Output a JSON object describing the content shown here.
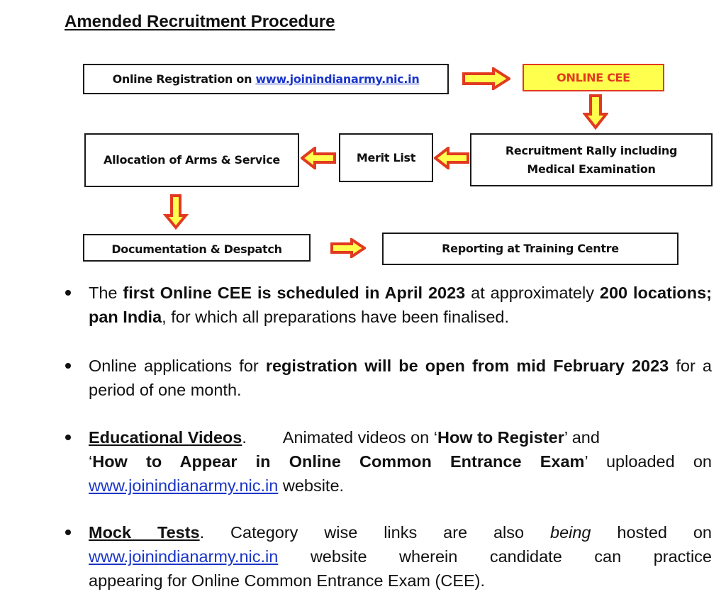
{
  "title": "Amended Recruitment Procedure",
  "flowchart": {
    "steps": {
      "registration": {
        "prefix": "Online Registration on ",
        "link": "www.joinindianarmy.nic.in"
      },
      "online_cee": "ONLINE CEE",
      "rally": {
        "line1": "Recruitment Rally including",
        "line2": "Medical Examination"
      },
      "merit_list": "Merit List",
      "allocation": "Allocation of Arms & Service",
      "documentation": "Documentation & Despatch",
      "reporting": "Reporting at Training Centre"
    },
    "colors": {
      "arrow_fill": "#ffff4d",
      "arrow_stroke": "#e23a20",
      "cee_fill": "#ffff4d",
      "cee_text": "#e23a20"
    }
  },
  "bullets": [
    {
      "t1": "The ",
      "b1": "first Online CEE is scheduled in April 2023",
      "t2": " at approximately ",
      "b2": "200 locations; pan India",
      "t3": ", for which all preparations have been finalised."
    },
    {
      "t1": "Online applications for ",
      "b1": "registration will be open from mid February 2023",
      "t2": " for a period of one month."
    },
    {
      "heading": "Educational Videos",
      "t1": ".        Animated videos on ‘",
      "b1": "How to Register",
      "t2": "’ and",
      "t3": "‘",
      "b2": "How to Appear in Online Common Entrance Exam",
      "t4": "’ uploaded on",
      "link": "www.joinindianarmy.nic.in",
      "t5": " website."
    },
    {
      "heading": "Mock Tests",
      "t1": ".  Category wise links are also ",
      "i1": "being",
      "t2": " hosted on",
      "link": "www.joinindianarmy.nic.in",
      "t3": " website wherein candidate can practice",
      "t4": "appearing for Online Common Entrance Exam (CEE)."
    }
  ]
}
